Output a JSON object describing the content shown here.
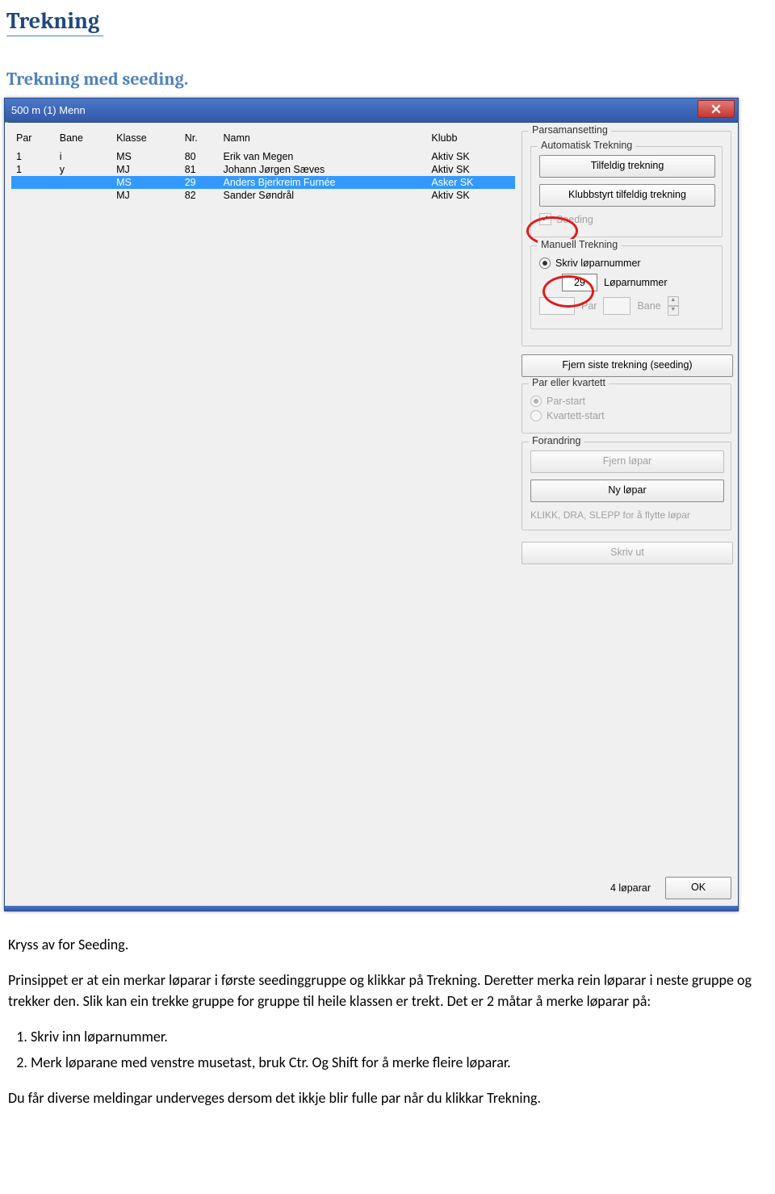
{
  "doc": {
    "title": "Trekning",
    "subtitle": "Trekning med seeding."
  },
  "window": {
    "title": "500 m (1) Menn"
  },
  "table": {
    "headers": {
      "par": "Par",
      "bane": "Bane",
      "klasse": "Klasse",
      "nr": "Nr.",
      "namn": "Namn",
      "klubb": "Klubb"
    },
    "rows": [
      {
        "par": "1",
        "bane": "i",
        "klasse": "MS",
        "nr": "80",
        "namn": "Erik van Megen",
        "klubb": "Aktiv SK",
        "selected": false
      },
      {
        "par": "1",
        "bane": "y",
        "klasse": "MJ",
        "nr": "81",
        "namn": "Johann Jørgen Sæves",
        "klubb": "Aktiv SK",
        "selected": false
      },
      {
        "par": "",
        "bane": "",
        "klasse": "MS",
        "nr": "29",
        "namn": "Anders Bjerkreim Furnée",
        "klubb": "Asker SK",
        "selected": true
      },
      {
        "par": "",
        "bane": "",
        "klasse": "MJ",
        "nr": "82",
        "namn": "Sander Søndrål",
        "klubb": "Aktiv SK",
        "selected": false
      }
    ]
  },
  "panel": {
    "parsamansetting": "Parsamansetting",
    "automatisk": {
      "legend": "Automatisk Trekning",
      "tilfeldig": "Tilfeldig trekning",
      "klubbstyrt": "Klubbstyrt tilfeldig trekning",
      "seeding": "Seeding"
    },
    "manuell": {
      "legend": "Manuell Trekning",
      "skriv_radio": "Skriv løparnummer",
      "loparnummer_label": "Løparnummer",
      "loparnummer_value": "29",
      "par_label": "Par",
      "bane_label": "Bane"
    },
    "fjern_siste": "Fjern siste trekning (seeding)",
    "par_eller": {
      "legend": "Par eller kvartett",
      "par_start": "Par-start",
      "kvartett_start": "Kvartett-start"
    },
    "forandring": {
      "legend": "Forandring",
      "fjern_lopar": "Fjern løpar",
      "ny_lopar": "Ny løpar",
      "help": "KLIKK, DRA, SLEPP for å flytte løpar"
    },
    "skriv_ut": "Skriv ut",
    "counter": "4 løparar",
    "ok": "OK"
  },
  "body": {
    "p1": "Kryss av for Seeding.",
    "p2": "Prinsippet er at ein merkar løparar i første seedinggruppe og klikkar på Trekning. Deretter merka rein løparar i neste gruppe og trekker den. Slik kan ein trekke gruppe for gruppe til heile klassen er trekt. Det er 2 måtar å merke løparar på:",
    "li1": "Skriv inn løparnummer.",
    "li2": "Merk løparane med venstre musetast, bruk Ctr. Og Shift for å merke fleire løparar.",
    "p3": "Du får diverse meldingar underveges dersom det ikkje blir fulle par når du klikkar Trekning."
  }
}
